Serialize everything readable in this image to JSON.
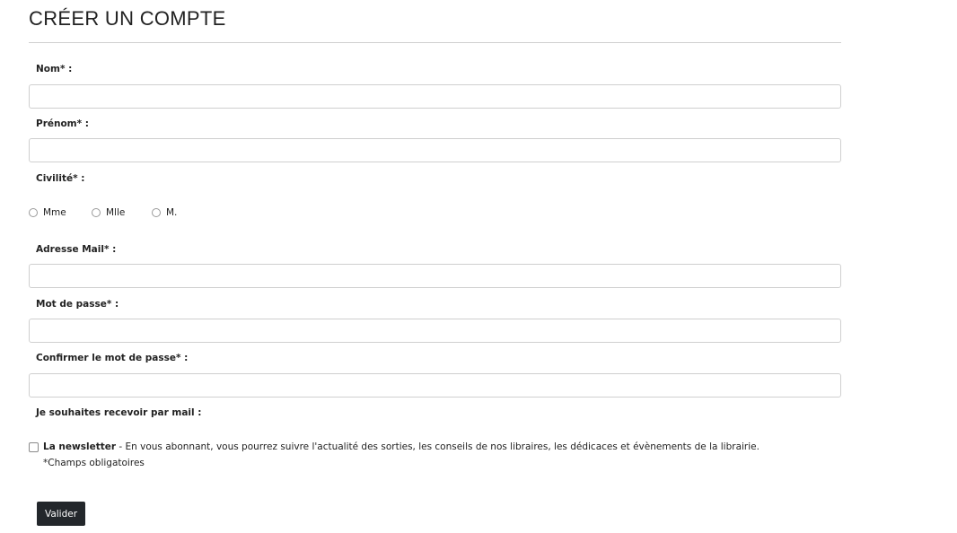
{
  "form": {
    "title": "CRÉER UN COMPTE",
    "fields": {
      "nom": {
        "label": "Nom* :",
        "value": "",
        "placeholder": ""
      },
      "prenom": {
        "label": "Prénom* :",
        "value": "",
        "placeholder": ""
      },
      "email": {
        "label": "Adresse Mail* :",
        "value": "",
        "placeholder": ""
      },
      "password": {
        "label": "Mot de passe* :",
        "value": "",
        "placeholder": ""
      },
      "password_confirm": {
        "label": "Confirmer le mot de passe* :",
        "value": "",
        "placeholder": ""
      }
    },
    "civilite": {
      "label": "Civilité* :",
      "options": [
        "Mme",
        "Mlle",
        "M."
      ],
      "selected": null
    },
    "subscriptions": {
      "label": "Je souhaites recevoir par mail :",
      "newsletter_title": "La newsletter",
      "newsletter_desc": " - En vous abonnant, vous pourrez suivre l'actualité des sorties, les conseils de nos libraires, les dédicaces et évènements de la librairie.",
      "newsletter_checked": false
    },
    "required_note": "*Champs obligatoires",
    "submit_label": "Valider"
  },
  "colors": {
    "button_bg": "#23272b",
    "border": "#cfcfcf",
    "text": "#222222"
  }
}
